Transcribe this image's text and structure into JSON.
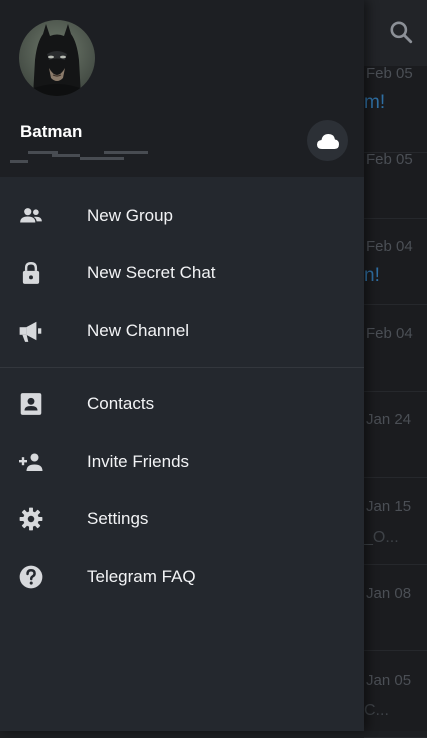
{
  "user": {
    "name": "Batman"
  },
  "menu": {
    "group1": [
      {
        "label": "New Group",
        "icon": "group-icon"
      },
      {
        "label": "New Secret Chat",
        "icon": "lock-icon"
      },
      {
        "label": "New Channel",
        "icon": "megaphone-icon"
      }
    ],
    "group2": [
      {
        "label": "Contacts",
        "icon": "contact-card-icon"
      },
      {
        "label": "Invite Friends",
        "icon": "add-person-icon"
      },
      {
        "label": "Settings",
        "icon": "gear-icon"
      },
      {
        "label": "Telegram FAQ",
        "icon": "help-icon"
      }
    ]
  },
  "chat_list": {
    "dates": [
      "Feb 05",
      "Feb 05",
      "Feb 04",
      "Feb 04",
      "Jan 24",
      "Jan 15",
      "Jan 08",
      "Jan 05"
    ],
    "snippets": [
      "m!",
      "n!",
      "_O...",
      "C..."
    ]
  },
  "colors": {
    "drawer_bg": "#24282e",
    "header_bg": "#1d1f23",
    "text": "#f2f3f5",
    "icon": "#d7d9dc",
    "accent_link": "#2f6fa3"
  }
}
